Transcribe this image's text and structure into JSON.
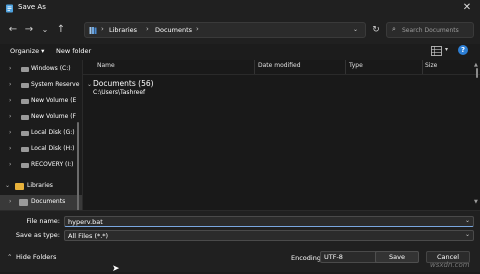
{
  "window": {
    "title": "Save As"
  },
  "titlebar": {
    "close_glyph": "✕"
  },
  "nav": {
    "back_glyph": "←",
    "forward_glyph": "→",
    "history_glyph": "⌄",
    "up_glyph": "↑",
    "breadcrumb": [
      "Libraries",
      "Documents"
    ],
    "refresh_glyph": "↻",
    "search_placeholder": "Search Documents"
  },
  "toolbar": {
    "organize_label": "Organize ▾",
    "newfolder_label": "New folder",
    "help_glyph": "?"
  },
  "sidebar": {
    "items": [
      {
        "label": "Windows (C:)"
      },
      {
        "label": "System Reserve"
      },
      {
        "label": "New Volume (E"
      },
      {
        "label": "New Volume (F"
      },
      {
        "label": "Local Disk (G:)"
      },
      {
        "label": "Local Disk (H:)"
      },
      {
        "label": "RECOVERY (I:)"
      },
      {
        "label": "Libraries"
      },
      {
        "label": "Documents"
      }
    ]
  },
  "filelist": {
    "columns": [
      "Name",
      "Date modified",
      "Type",
      "Size"
    ],
    "group_title": "Documents (56)",
    "group_path": "C:\\Users\\Tashreef"
  },
  "bottom": {
    "filename_label": "File name:",
    "filename_value": "hyperv.bat",
    "type_label": "Save as type:",
    "type_value": "All Files  (*.*)",
    "hide_folders_label": "Hide Folders",
    "encoding_label": "Encoding:",
    "encoding_value": "UTF-8",
    "save_label": "Save",
    "cancel_label": "Cancel",
    "watermark": "wsxdn.com"
  },
  "colors": {
    "accent": "#2d7fd5",
    "folder": "#e8b23b",
    "background": "#1c1c1c"
  }
}
